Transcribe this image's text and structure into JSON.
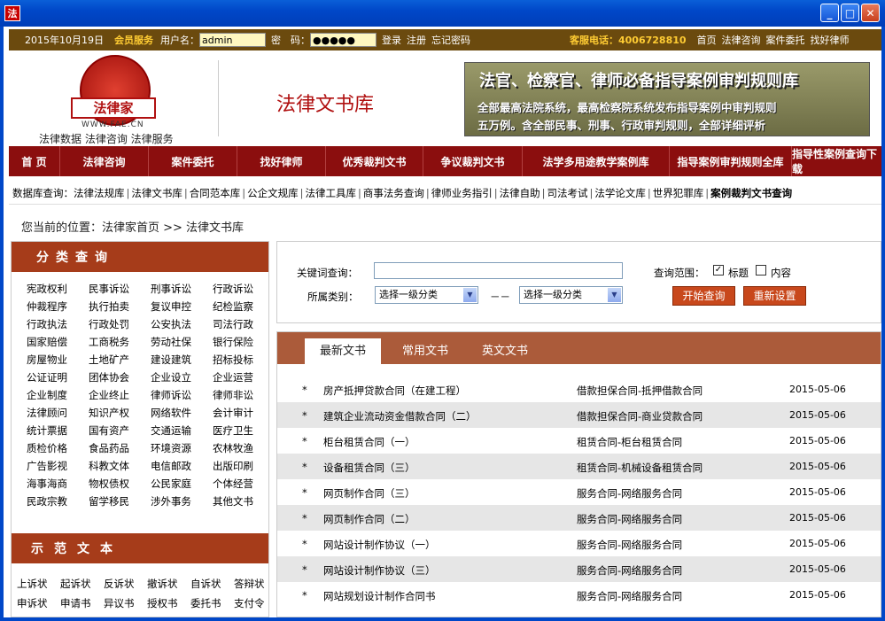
{
  "window": {
    "icon": "法"
  },
  "topbar": {
    "date": "2015年10月19日",
    "member": "会员服务",
    "user_label": "用户名：",
    "user_value": "admin",
    "pwd_label": "密　码：",
    "pwd_value": "●●●●●",
    "links": [
      "登录",
      "注册",
      "忘记密码"
    ],
    "hotline": "客服电话：4006728810",
    "right_links": [
      "首页",
      "法律咨询",
      "案件委托",
      "找好律师"
    ]
  },
  "header": {
    "logo_text": "法律家",
    "logo_url": "WWW.FAE.CN",
    "tagline": "法律数据 法律咨询 法律服务",
    "page_title": "法律文书库",
    "banner": {
      "line1": "法官、检察官、律师必备指导案例审判规则库",
      "line2": "全部最高法院系统，最高检察院系统发布指导案例中审判规则",
      "line3": "五万例。含全部民事、刑事、行政审判规则，全部详细评析"
    }
  },
  "nav": [
    "首 页",
    "法律咨询",
    "案件委托",
    "找好律师",
    "优秀裁判文书",
    "争议裁判文书",
    "法学多用途教学案例库",
    "指导案例审判规则全库",
    "指导性案例查询下载"
  ],
  "subnav": {
    "label": "数据库查询：",
    "items": [
      "法律法规库",
      "法律文书库",
      "合同范本库",
      "公企文规库",
      "法律工具库",
      "商事法务查询",
      "律师业务指引",
      "法律自助",
      "司法考试",
      "法学论文库",
      "世界犯罪库"
    ],
    "last": "案例裁判文书查询"
  },
  "breadcrumb": "您当前的位置：法律家首页 >> 法律文书库",
  "categories": {
    "title": "分类查询",
    "items": [
      "宪政权利",
      "民事诉讼",
      "刑事诉讼",
      "行政诉讼",
      "仲裁程序",
      "执行拍卖",
      "复议申控",
      "纪检监察",
      "行政执法",
      "行政处罚",
      "公安执法",
      "司法行政",
      "国家赔偿",
      "工商税务",
      "劳动社保",
      "银行保险",
      "房屋物业",
      "土地矿产",
      "建设建筑",
      "招标投标",
      "公证证明",
      "团体协会",
      "企业设立",
      "企业运营",
      "企业制度",
      "企业终止",
      "律师诉讼",
      "律师非讼",
      "法律顾问",
      "知识产权",
      "网络软件",
      "会计审计",
      "统计票据",
      "国有资产",
      "交通运输",
      "医疗卫生",
      "质检价格",
      "食品药品",
      "环境资源",
      "农林牧渔",
      "广告影视",
      "科教文体",
      "电信邮政",
      "出版印刷",
      "海事海商",
      "物权债权",
      "公民家庭",
      "个体经营",
      "民政宗教",
      "留学移民",
      "涉外事务",
      "其他文书"
    ]
  },
  "samples": {
    "title": "示范文本",
    "items": [
      "上诉状",
      "起诉状",
      "反诉状",
      "撤诉状",
      "自诉状",
      "答辩状",
      "申诉状",
      "申请书",
      "异议书",
      "授权书",
      "委托书",
      "支付令"
    ]
  },
  "search": {
    "keyword_label": "关键词查询：",
    "category_label": "所属类别：",
    "select1": "选择一级分类",
    "dash": "－－",
    "select2": "选择一级分类",
    "scope_label": "查询范围：",
    "opt_title": "标题",
    "opt_content": "内容",
    "submit": "开始查询",
    "reset": "重新设置"
  },
  "tabs": [
    "最新文书",
    "常用文书",
    "英文文书"
  ],
  "docs": [
    {
      "title": "房产抵押贷款合同（在建工程）",
      "category": "借款担保合同-抵押借款合同",
      "date": "2015-05-06"
    },
    {
      "title": "建筑企业流动资金借款合同（二）",
      "category": "借款担保合同-商业贷款合同",
      "date": "2015-05-06"
    },
    {
      "title": "柜台租赁合同（一）",
      "category": "租赁合同-柜台租赁合同",
      "date": "2015-05-06"
    },
    {
      "title": "设备租赁合同（三）",
      "category": "租赁合同-机械设备租赁合同",
      "date": "2015-05-06"
    },
    {
      "title": "网页制作合同（三）",
      "category": "服务合同-网络服务合同",
      "date": "2015-05-06"
    },
    {
      "title": "网页制作合同（二）",
      "category": "服务合同-网络服务合同",
      "date": "2015-05-06"
    },
    {
      "title": "网站设计制作协议（一）",
      "category": "服务合同-网络服务合同",
      "date": "2015-05-06"
    },
    {
      "title": "网站设计制作协议（三）",
      "category": "服务合同-网络服务合同",
      "date": "2015-05-06"
    },
    {
      "title": "网站规划设计制作合同书",
      "category": "服务合同-网络服务合同",
      "date": "2015-05-06"
    }
  ],
  "bullet": "*"
}
